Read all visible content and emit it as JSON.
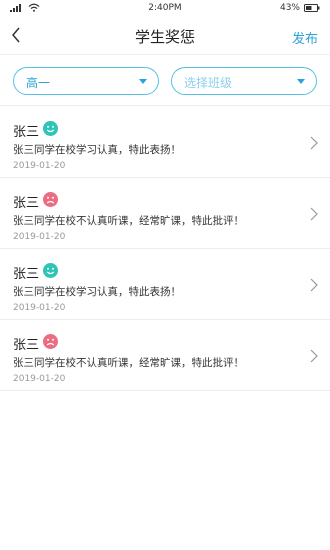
{
  "status": {
    "time": "2:40PM",
    "battery": "43%"
  },
  "header": {
    "title": "学生奖惩",
    "action": "发布"
  },
  "filters": {
    "grade": "高一",
    "class_placeholder": "选择班级"
  },
  "records": [
    {
      "name": "张三",
      "mood": "happy",
      "text": "张三同学在校学习认真，特此表扬！",
      "date": "2019-01-20"
    },
    {
      "name": "张三",
      "mood": "sad",
      "text": "张三同学在校不认真听课，经常旷课，特此批评！",
      "date": "2019-01-20"
    },
    {
      "name": "张三",
      "mood": "happy",
      "text": "张三同学在校学习认真，特此表扬！",
      "date": "2019-01-20"
    },
    {
      "name": "张三",
      "mood": "sad",
      "text": "张三同学在校不认真听课，经常旷课，特此批评！",
      "date": "2019-01-20"
    }
  ],
  "colors": {
    "accent": "#2ba3d9",
    "praise": "#2ec4b6",
    "criticism": "#ea6d82"
  }
}
